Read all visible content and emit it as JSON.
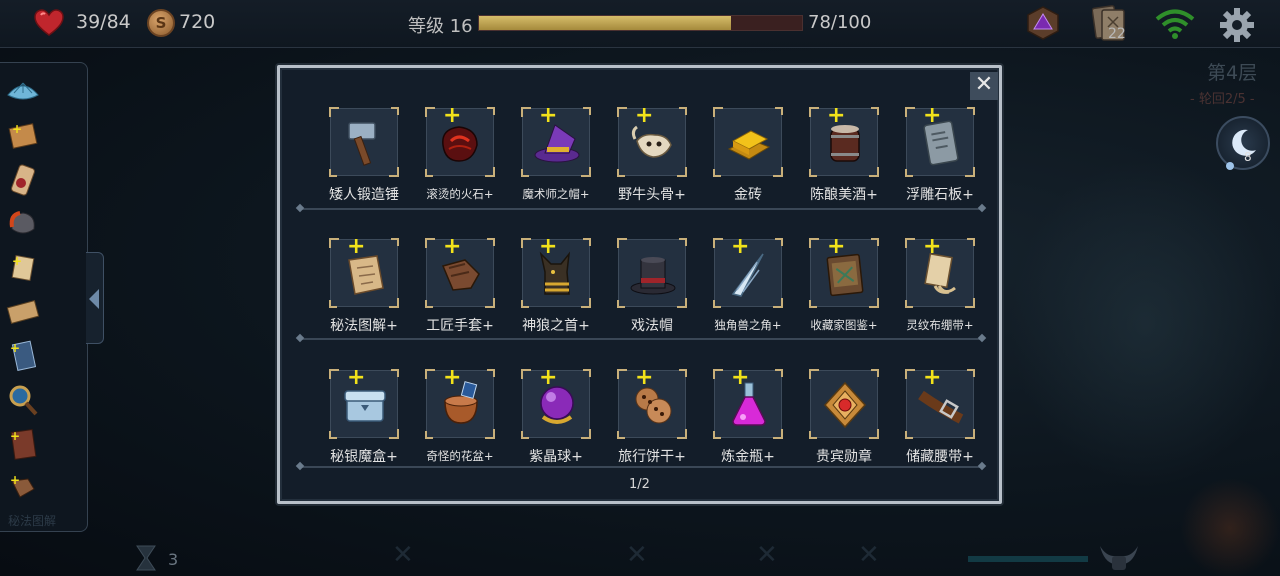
{
  "hud": {
    "hp": "39/84",
    "gold": "720",
    "coin_symbol": "S",
    "level_label": "等级 16",
    "xp_text": "78/100",
    "xp_fraction": 0.78,
    "cards_count": "22",
    "icons": [
      "heart-icon",
      "coin-icon",
      "d20-gem-icon",
      "tarot-cards-icon",
      "wifi-icon",
      "gear-icon"
    ]
  },
  "dungeon": {
    "floor": "第4层",
    "subtitle": "- 轮回2/5 -",
    "moon_count": "8"
  },
  "sidebar": {
    "items": [
      "clam-shell",
      "map-scroll",
      "sealed-scroll",
      "flame-rock",
      "bandaged-scroll",
      "parchment",
      "tarot-card",
      "magnifier",
      "spellbook",
      "gloves"
    ],
    "bottom_text": "秘法图解"
  },
  "bottom": {
    "hourglass_count": "3"
  },
  "modal": {
    "close_label": "✕",
    "page": "1/2",
    "rows": [
      [
        {
          "name": "矮人锻造锤",
          "plus": false,
          "icon": "hammer-icon",
          "small": false
        },
        {
          "name": "滚烫的火石+",
          "plus": true,
          "icon": "fire-stone-icon",
          "small": true
        },
        {
          "name": "魔术师之帽+",
          "plus": true,
          "icon": "wizard-hat-icon",
          "small": true
        },
        {
          "name": "野牛头骨+",
          "plus": true,
          "icon": "bison-skull-icon",
          "small": false
        },
        {
          "name": "金砖",
          "plus": false,
          "icon": "gold-bar-icon",
          "small": false
        },
        {
          "name": "陈酿美酒+",
          "plus": true,
          "icon": "wine-barrel-icon",
          "small": false
        },
        {
          "name": "浮雕石板+",
          "plus": true,
          "icon": "stone-tablet-icon",
          "small": false
        }
      ],
      [
        {
          "name": "秘法图解+",
          "plus": true,
          "icon": "arcane-scroll-icon",
          "small": false
        },
        {
          "name": "工匠手套+",
          "plus": true,
          "icon": "craftsman-gloves-icon",
          "small": false
        },
        {
          "name": "神狼之首+",
          "plus": true,
          "icon": "anubis-head-icon",
          "small": false
        },
        {
          "name": "戏法帽",
          "plus": false,
          "icon": "top-hat-icon",
          "small": false
        },
        {
          "name": "独角兽之角+",
          "plus": true,
          "icon": "unicorn-horn-icon",
          "small": true
        },
        {
          "name": "收藏家图鉴+",
          "plus": true,
          "icon": "collector-book-icon",
          "small": true
        },
        {
          "name": "灵纹布绷带+",
          "plus": true,
          "icon": "rune-bandage-icon",
          "small": true
        }
      ],
      [
        {
          "name": "秘银魔盒+",
          "plus": true,
          "icon": "mithril-box-icon",
          "small": false
        },
        {
          "name": "奇怪的花盆+",
          "plus": true,
          "icon": "strange-pot-icon",
          "small": true
        },
        {
          "name": "紫晶球+",
          "plus": true,
          "icon": "amethyst-orb-icon",
          "small": false
        },
        {
          "name": "旅行饼干+",
          "plus": true,
          "icon": "travel-cookies-icon",
          "small": false
        },
        {
          "name": "炼金瓶+",
          "plus": true,
          "icon": "alchemy-flask-icon",
          "small": false
        },
        {
          "name": "贵宾勋章",
          "plus": false,
          "icon": "vip-medal-icon",
          "small": false
        },
        {
          "name": "储藏腰带+",
          "plus": true,
          "icon": "storage-belt-icon",
          "small": false
        }
      ]
    ]
  }
}
